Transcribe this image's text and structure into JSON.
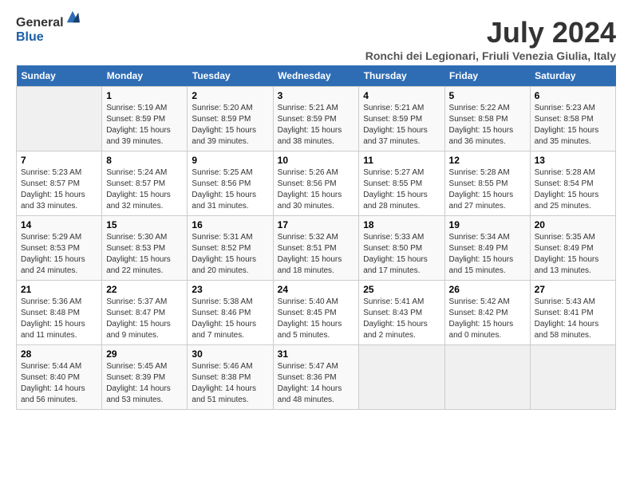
{
  "logo": {
    "general": "General",
    "blue": "Blue"
  },
  "title": "July 2024",
  "subtitle": "Ronchi dei Legionari, Friuli Venezia Giulia, Italy",
  "days_of_week": [
    "Sunday",
    "Monday",
    "Tuesday",
    "Wednesday",
    "Thursday",
    "Friday",
    "Saturday"
  ],
  "weeks": [
    [
      {
        "day": "",
        "sunrise": "",
        "sunset": "",
        "daylight": ""
      },
      {
        "day": "1",
        "sunrise": "5:19 AM",
        "sunset": "8:59 PM",
        "daylight": "15 hours and 39 minutes."
      },
      {
        "day": "2",
        "sunrise": "5:20 AM",
        "sunset": "8:59 PM",
        "daylight": "15 hours and 39 minutes."
      },
      {
        "day": "3",
        "sunrise": "5:21 AM",
        "sunset": "8:59 PM",
        "daylight": "15 hours and 38 minutes."
      },
      {
        "day": "4",
        "sunrise": "5:21 AM",
        "sunset": "8:59 PM",
        "daylight": "15 hours and 37 minutes."
      },
      {
        "day": "5",
        "sunrise": "5:22 AM",
        "sunset": "8:58 PM",
        "daylight": "15 hours and 36 minutes."
      },
      {
        "day": "6",
        "sunrise": "5:23 AM",
        "sunset": "8:58 PM",
        "daylight": "15 hours and 35 minutes."
      }
    ],
    [
      {
        "day": "7",
        "sunrise": "5:23 AM",
        "sunset": "8:57 PM",
        "daylight": "15 hours and 33 minutes."
      },
      {
        "day": "8",
        "sunrise": "5:24 AM",
        "sunset": "8:57 PM",
        "daylight": "15 hours and 32 minutes."
      },
      {
        "day": "9",
        "sunrise": "5:25 AM",
        "sunset": "8:56 PM",
        "daylight": "15 hours and 31 minutes."
      },
      {
        "day": "10",
        "sunrise": "5:26 AM",
        "sunset": "8:56 PM",
        "daylight": "15 hours and 30 minutes."
      },
      {
        "day": "11",
        "sunrise": "5:27 AM",
        "sunset": "8:55 PM",
        "daylight": "15 hours and 28 minutes."
      },
      {
        "day": "12",
        "sunrise": "5:28 AM",
        "sunset": "8:55 PM",
        "daylight": "15 hours and 27 minutes."
      },
      {
        "day": "13",
        "sunrise": "5:28 AM",
        "sunset": "8:54 PM",
        "daylight": "15 hours and 25 minutes."
      }
    ],
    [
      {
        "day": "14",
        "sunrise": "5:29 AM",
        "sunset": "8:53 PM",
        "daylight": "15 hours and 24 minutes."
      },
      {
        "day": "15",
        "sunrise": "5:30 AM",
        "sunset": "8:53 PM",
        "daylight": "15 hours and 22 minutes."
      },
      {
        "day": "16",
        "sunrise": "5:31 AM",
        "sunset": "8:52 PM",
        "daylight": "15 hours and 20 minutes."
      },
      {
        "day": "17",
        "sunrise": "5:32 AM",
        "sunset": "8:51 PM",
        "daylight": "15 hours and 18 minutes."
      },
      {
        "day": "18",
        "sunrise": "5:33 AM",
        "sunset": "8:50 PM",
        "daylight": "15 hours and 17 minutes."
      },
      {
        "day": "19",
        "sunrise": "5:34 AM",
        "sunset": "8:49 PM",
        "daylight": "15 hours and 15 minutes."
      },
      {
        "day": "20",
        "sunrise": "5:35 AM",
        "sunset": "8:49 PM",
        "daylight": "15 hours and 13 minutes."
      }
    ],
    [
      {
        "day": "21",
        "sunrise": "5:36 AM",
        "sunset": "8:48 PM",
        "daylight": "15 hours and 11 minutes."
      },
      {
        "day": "22",
        "sunrise": "5:37 AM",
        "sunset": "8:47 PM",
        "daylight": "15 hours and 9 minutes."
      },
      {
        "day": "23",
        "sunrise": "5:38 AM",
        "sunset": "8:46 PM",
        "daylight": "15 hours and 7 minutes."
      },
      {
        "day": "24",
        "sunrise": "5:40 AM",
        "sunset": "8:45 PM",
        "daylight": "15 hours and 5 minutes."
      },
      {
        "day": "25",
        "sunrise": "5:41 AM",
        "sunset": "8:43 PM",
        "daylight": "15 hours and 2 minutes."
      },
      {
        "day": "26",
        "sunrise": "5:42 AM",
        "sunset": "8:42 PM",
        "daylight": "15 hours and 0 minutes."
      },
      {
        "day": "27",
        "sunrise": "5:43 AM",
        "sunset": "8:41 PM",
        "daylight": "14 hours and 58 minutes."
      }
    ],
    [
      {
        "day": "28",
        "sunrise": "5:44 AM",
        "sunset": "8:40 PM",
        "daylight": "14 hours and 56 minutes."
      },
      {
        "day": "29",
        "sunrise": "5:45 AM",
        "sunset": "8:39 PM",
        "daylight": "14 hours and 53 minutes."
      },
      {
        "day": "30",
        "sunrise": "5:46 AM",
        "sunset": "8:38 PM",
        "daylight": "14 hours and 51 minutes."
      },
      {
        "day": "31",
        "sunrise": "5:47 AM",
        "sunset": "8:36 PM",
        "daylight": "14 hours and 48 minutes."
      },
      {
        "day": "",
        "sunrise": "",
        "sunset": "",
        "daylight": ""
      },
      {
        "day": "",
        "sunrise": "",
        "sunset": "",
        "daylight": ""
      },
      {
        "day": "",
        "sunrise": "",
        "sunset": "",
        "daylight": ""
      }
    ]
  ]
}
